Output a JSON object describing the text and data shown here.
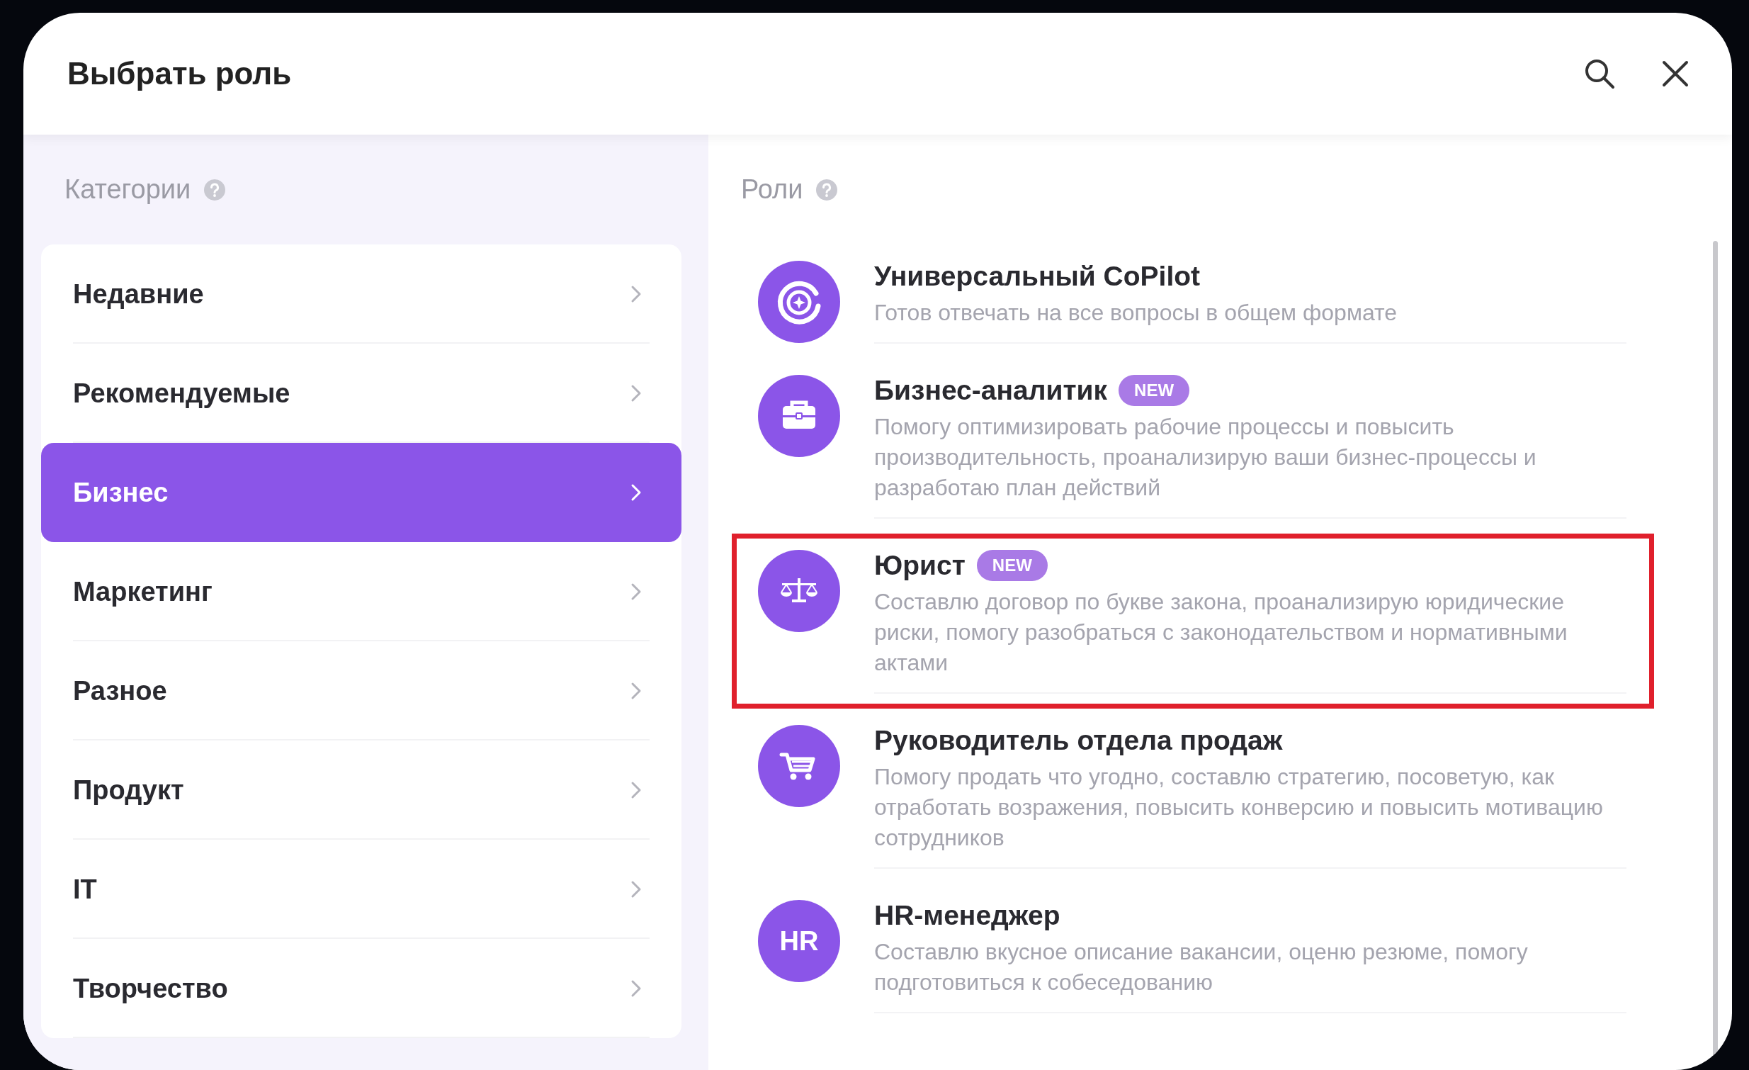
{
  "window": {
    "title": "Выбрать роль"
  },
  "categories": {
    "title": "Категории",
    "items": [
      {
        "label": "Недавние",
        "selected": false
      },
      {
        "label": "Рекомендуемые",
        "selected": false
      },
      {
        "label": "Бизнес",
        "selected": true
      },
      {
        "label": "Маркетинг",
        "selected": false
      },
      {
        "label": "Разное",
        "selected": false
      },
      {
        "label": "Продукт",
        "selected": false
      },
      {
        "label": "IT",
        "selected": false
      },
      {
        "label": "Творчество",
        "selected": false
      }
    ]
  },
  "roles": {
    "title": "Роли",
    "items": [
      {
        "icon": {
          "kind": "copilot"
        },
        "name": "Универсальный CoPilot",
        "description": "Готов отвечать на все вопросы в общем формате",
        "highlighted": false
      },
      {
        "icon": {
          "kind": "briefcase"
        },
        "name": "Бизнес-аналитик",
        "badge": "NEW",
        "description": "Помогу оптимизировать рабочие процессы и повысить производительность, проанализирую ваши бизнес-процессы и разработаю план действий",
        "highlighted": false
      },
      {
        "icon": {
          "kind": "scales"
        },
        "name": "Юрист",
        "badge": "NEW",
        "description": "Составлю договор по букве закона, проанализирую юридические риски, помогу разобраться с законодательством и нормативными актами",
        "highlighted": true
      },
      {
        "icon": {
          "kind": "cart"
        },
        "name": "Руководитель отдела продаж",
        "description": "Помогу продать что угодно, составлю стратегию, посоветую, как отработать возражения, повысить конверсию и повысить мотивацию сотрудников",
        "highlighted": false
      },
      {
        "icon": {
          "kind": "text",
          "text": "HR"
        },
        "name": "HR-менеджер",
        "description": "Составлю вкусное описание вакансии, оценю резюме, помогу подготовиться к собеседованию",
        "highlighted": false
      }
    ]
  }
}
